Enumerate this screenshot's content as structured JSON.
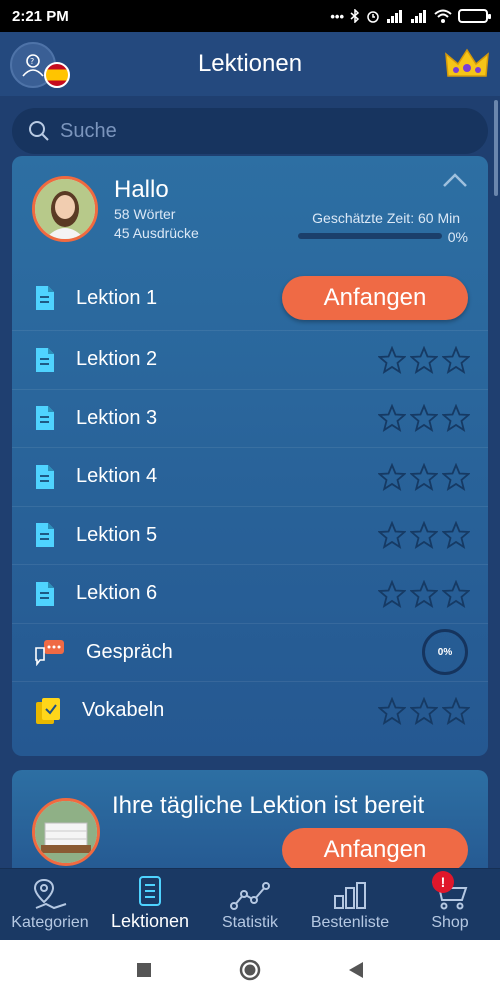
{
  "status": {
    "time": "2:21 PM"
  },
  "header": {
    "title": "Lektionen"
  },
  "search": {
    "placeholder": "Suche"
  },
  "profile": {
    "greeting": "Hallo",
    "words": "58 Wörter",
    "phrases": "45 Ausdrücke",
    "estimate": "Geschätzte Zeit: 60 Min",
    "progress_text": "0%",
    "progress_value": 0
  },
  "lessons": [
    {
      "label": "Lektion 1",
      "action": "Anfangen"
    },
    {
      "label": "Lektion 2",
      "stars": 0
    },
    {
      "label": "Lektion 3",
      "stars": 0
    },
    {
      "label": "Lektion 4",
      "stars": 0
    },
    {
      "label": "Lektion 5",
      "stars": 0
    },
    {
      "label": "Lektion 6",
      "stars": 0
    }
  ],
  "extras": {
    "conversation": {
      "label": "Gespräch",
      "progress": "0%"
    },
    "vocabulary": {
      "label": "Vokabeln",
      "stars": 0
    }
  },
  "daily": {
    "title": "Ihre tägliche Lektion ist bereit",
    "button": "Anfangen"
  },
  "nav": {
    "categories": "Kategorien",
    "lessons": "Lektionen",
    "stats": "Statistik",
    "leaderboard": "Bestenliste",
    "shop": "Shop",
    "shop_badge": "!"
  },
  "colors": {
    "accent": "#ef6a45",
    "background": "#1f3f70",
    "card": "#2d6fa3",
    "icon": "#4fd3ff"
  }
}
